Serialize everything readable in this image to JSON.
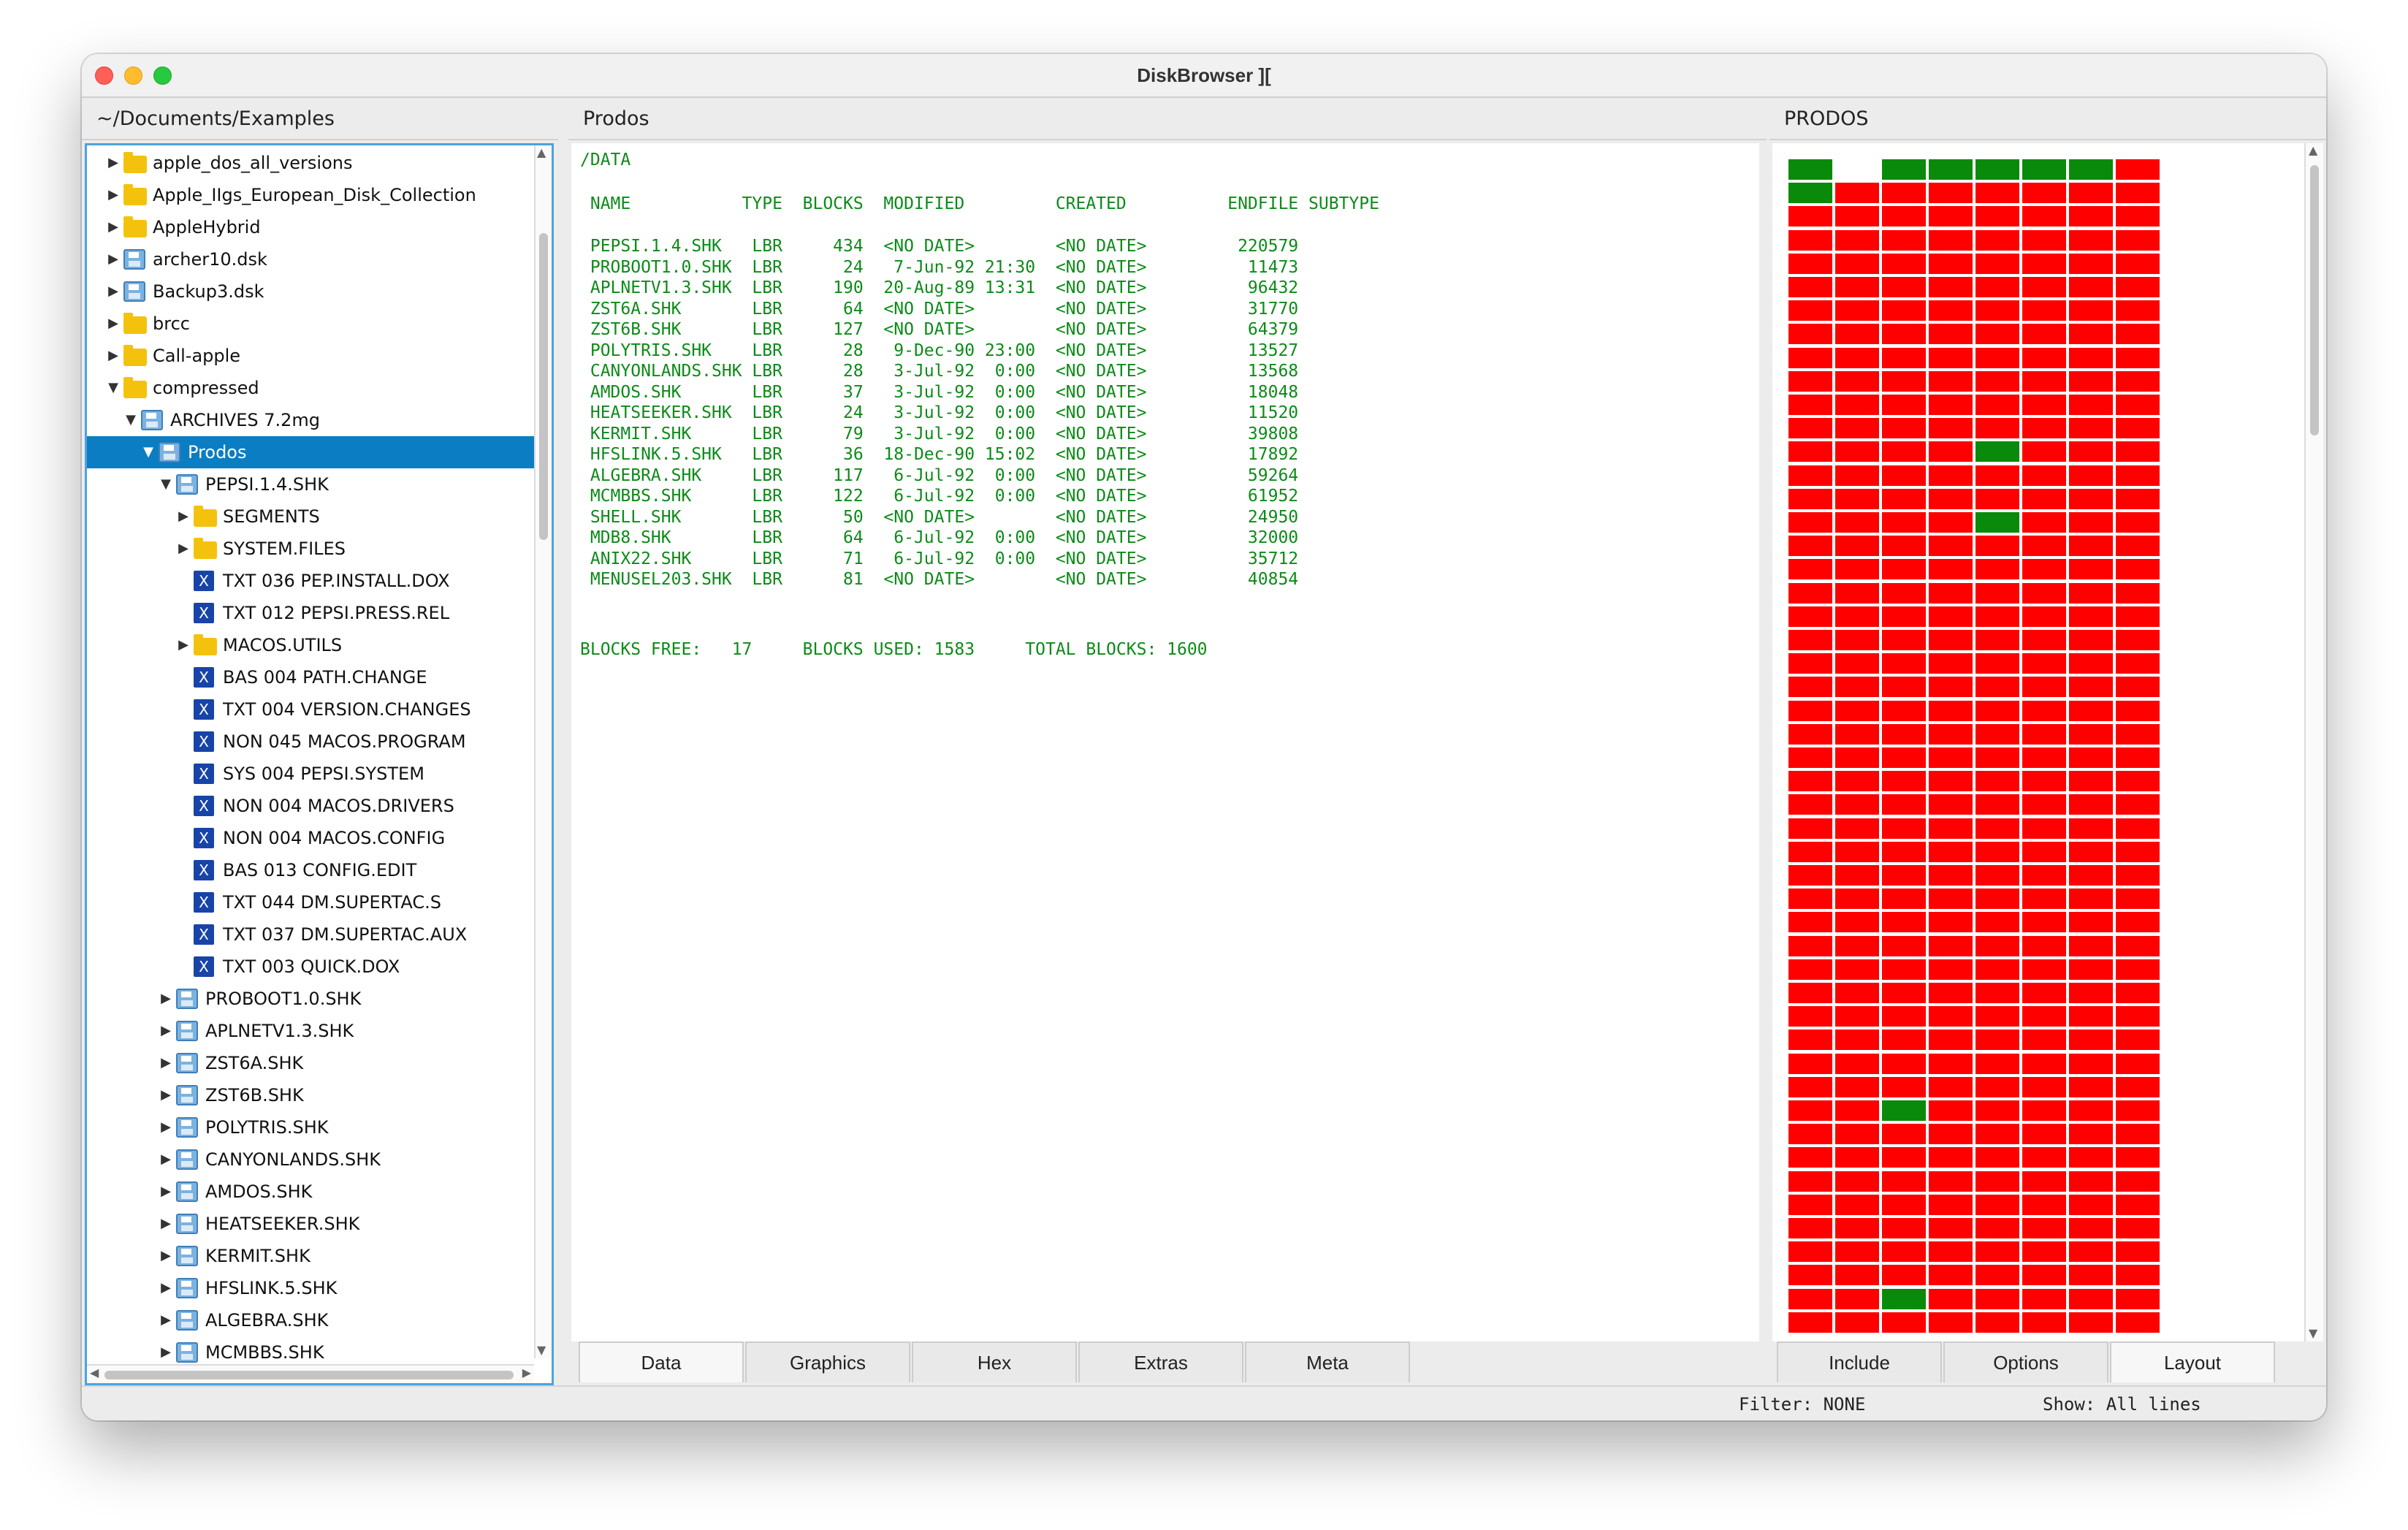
{
  "window": {
    "title": "DiskBrowser ]["
  },
  "tree": {
    "path": "~/Documents/Examples",
    "rows": [
      {
        "label": "apple_dos_all_versions",
        "indent": 1,
        "icon": "folder",
        "arrow": "right"
      },
      {
        "label": "Apple_IIgs_European_Disk_Collection",
        "indent": 1,
        "icon": "folder",
        "arrow": "right"
      },
      {
        "label": "AppleHybrid",
        "indent": 1,
        "icon": "folder",
        "arrow": "right"
      },
      {
        "label": "archer10.dsk",
        "indent": 1,
        "icon": "disk",
        "arrow": "right"
      },
      {
        "label": "Backup3.dsk",
        "indent": 1,
        "icon": "disk",
        "arrow": "right"
      },
      {
        "label": "brcc",
        "indent": 1,
        "icon": "folder",
        "arrow": "right"
      },
      {
        "label": "Call-apple",
        "indent": 1,
        "icon": "folder",
        "arrow": "right"
      },
      {
        "label": "compressed",
        "indent": 1,
        "icon": "folder",
        "arrow": "down"
      },
      {
        "label": "ARCHIVES 7.2mg",
        "indent": 2,
        "icon": "disk",
        "arrow": "down"
      },
      {
        "label": "Prodos",
        "indent": 3,
        "icon": "disk",
        "arrow": "down",
        "selected": true
      },
      {
        "label": "PEPSI.1.4.SHK",
        "indent": 4,
        "icon": "disk",
        "arrow": "down"
      },
      {
        "label": "SEGMENTS",
        "indent": 5,
        "icon": "folder",
        "arrow": "right"
      },
      {
        "label": "SYSTEM.FILES",
        "indent": 5,
        "icon": "folder",
        "arrow": "right"
      },
      {
        "label": "TXT 036 PEP.INSTALL.DOX",
        "indent": 5,
        "icon": "file",
        "arrow": ""
      },
      {
        "label": "TXT 012 PEPSI.PRESS.REL",
        "indent": 5,
        "icon": "file",
        "arrow": ""
      },
      {
        "label": "MACOS.UTILS",
        "indent": 5,
        "icon": "folder",
        "arrow": "right"
      },
      {
        "label": "BAS 004 PATH.CHANGE",
        "indent": 5,
        "icon": "file",
        "arrow": ""
      },
      {
        "label": "TXT 004 VERSION.CHANGES",
        "indent": 5,
        "icon": "file",
        "arrow": ""
      },
      {
        "label": "NON 045 MACOS.PROGRAM",
        "indent": 5,
        "icon": "file",
        "arrow": ""
      },
      {
        "label": "SYS 004 PEPSI.SYSTEM",
        "indent": 5,
        "icon": "file",
        "arrow": ""
      },
      {
        "label": "NON 004 MACOS.DRIVERS",
        "indent": 5,
        "icon": "file",
        "arrow": ""
      },
      {
        "label": "NON 004 MACOS.CONFIG",
        "indent": 5,
        "icon": "file",
        "arrow": ""
      },
      {
        "label": "BAS 013 CONFIG.EDIT",
        "indent": 5,
        "icon": "file",
        "arrow": ""
      },
      {
        "label": "TXT 044 DM.SUPERTAC.S",
        "indent": 5,
        "icon": "file",
        "arrow": ""
      },
      {
        "label": "TXT 037 DM.SUPERTAC.AUX",
        "indent": 5,
        "icon": "file",
        "arrow": ""
      },
      {
        "label": "TXT 003 QUICK.DOX",
        "indent": 5,
        "icon": "file",
        "arrow": ""
      },
      {
        "label": "PROBOOT1.0.SHK",
        "indent": 4,
        "icon": "disk",
        "arrow": "right"
      },
      {
        "label": "APLNETV1.3.SHK",
        "indent": 4,
        "icon": "disk",
        "arrow": "right"
      },
      {
        "label": "ZST6A.SHK",
        "indent": 4,
        "icon": "disk",
        "arrow": "right"
      },
      {
        "label": "ZST6B.SHK",
        "indent": 4,
        "icon": "disk",
        "arrow": "right"
      },
      {
        "label": "POLYTRIS.SHK",
        "indent": 4,
        "icon": "disk",
        "arrow": "right"
      },
      {
        "label": "CANYONLANDS.SHK",
        "indent": 4,
        "icon": "disk",
        "arrow": "right"
      },
      {
        "label": "AMDOS.SHK",
        "indent": 4,
        "icon": "disk",
        "arrow": "right"
      },
      {
        "label": "HEATSEEKER.SHK",
        "indent": 4,
        "icon": "disk",
        "arrow": "right"
      },
      {
        "label": "KERMIT.SHK",
        "indent": 4,
        "icon": "disk",
        "arrow": "right"
      },
      {
        "label": "HFSLINK.5.SHK",
        "indent": 4,
        "icon": "disk",
        "arrow": "right"
      },
      {
        "label": "ALGEBRA.SHK",
        "indent": 4,
        "icon": "disk",
        "arrow": "right"
      },
      {
        "label": "MCMBBS.SHK",
        "indent": 4,
        "icon": "disk",
        "arrow": "right"
      }
    ]
  },
  "data_panel": {
    "header": "Prodos",
    "directory": "/DATA",
    "columns_line": " NAME           TYPE  BLOCKS  MODIFIED         CREATED          ENDFILE SUBTYPE",
    "rows": [
      " PEPSI.1.4.SHK   LBR     434  <NO DATE>        <NO DATE>         220579",
      " PROBOOT1.0.SHK  LBR      24   7-Jun-92 21:30  <NO DATE>          11473",
      " APLNETV1.3.SHK  LBR     190  20-Aug-89 13:31  <NO DATE>          96432",
      " ZST6A.SHK       LBR      64  <NO DATE>        <NO DATE>          31770",
      " ZST6B.SHK       LBR     127  <NO DATE>        <NO DATE>          64379",
      " POLYTRIS.SHK    LBR      28   9-Dec-90 23:00  <NO DATE>          13527",
      " CANYONLANDS.SHK LBR      28   3-Jul-92  0:00  <NO DATE>          13568",
      " AMDOS.SHK       LBR      37   3-Jul-92  0:00  <NO DATE>          18048",
      " HEATSEEKER.SHK  LBR      24   3-Jul-92  0:00  <NO DATE>          11520",
      " KERMIT.SHK      LBR      79   3-Jul-92  0:00  <NO DATE>          39808",
      " HFSLINK.5.SHK   LBR      36  18-Dec-90 15:02  <NO DATE>          17892",
      " ALGEBRA.SHK     LBR     117   6-Jul-92  0:00  <NO DATE>          59264",
      " MCMBBS.SHK      LBR     122   6-Jul-92  0:00  <NO DATE>          61952",
      " SHELL.SHK       LBR      50  <NO DATE>        <NO DATE>          24950",
      " MDB8.SHK        LBR      64   6-Jul-92  0:00  <NO DATE>          32000",
      " ANIX22.SHK      LBR      71   6-Jul-92  0:00  <NO DATE>          35712",
      " MENUSEL203.SHK  LBR      81  <NO DATE>        <NO DATE>          40854"
    ],
    "summary": "BLOCKS FREE:   17     BLOCKS USED: 1583     TOTAL BLOCKS: 1600",
    "tabs": [
      "Data",
      "Graphics",
      "Hex",
      "Extras",
      "Meta"
    ],
    "active_tab": "Data"
  },
  "map_panel": {
    "header": "PRODOS",
    "tabs": [
      "Include",
      "Options",
      "Layout"
    ],
    "colors": {
      "used": "#ff0000",
      "free": "#0a8a0a",
      "empty": "#ffffff"
    },
    "columns": 8,
    "visible_rows": 50,
    "special_cells": [
      {
        "row": 0,
        "col": 0,
        "state": "free"
      },
      {
        "row": 0,
        "col": 1,
        "state": "empty"
      },
      {
        "row": 0,
        "col": 2,
        "state": "free"
      },
      {
        "row": 0,
        "col": 3,
        "state": "free"
      },
      {
        "row": 0,
        "col": 4,
        "state": "free"
      },
      {
        "row": 0,
        "col": 5,
        "state": "free"
      },
      {
        "row": 0,
        "col": 6,
        "state": "free"
      },
      {
        "row": 1,
        "col": 0,
        "state": "free"
      },
      {
        "row": 12,
        "col": 4,
        "state": "free"
      },
      {
        "row": 15,
        "col": 4,
        "state": "free"
      },
      {
        "row": 40,
        "col": 2,
        "state": "free"
      },
      {
        "row": 48,
        "col": 2,
        "state": "free"
      }
    ]
  },
  "statusbar": {
    "filter": "Filter: NONE",
    "show": "Show: All lines"
  }
}
